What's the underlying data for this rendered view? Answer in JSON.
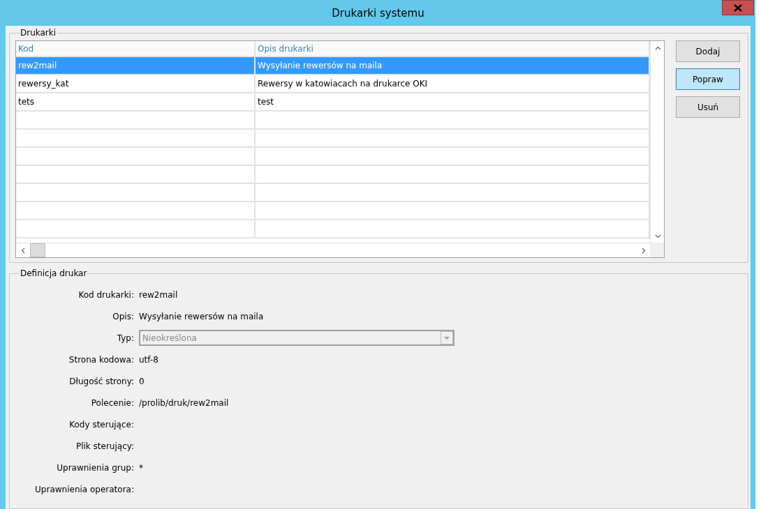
{
  "window": {
    "title": "Drukarki systemu"
  },
  "printers": {
    "legend": "Drukarki",
    "columns": [
      "Kod",
      "Opis drukarki"
    ],
    "rows": [
      {
        "cells": [
          "rew2mail",
          "Wysyłanie rewersów na maila"
        ],
        "selected": true
      },
      {
        "cells": [
          "rewersy_kat",
          "Rewersy w katowiacach na drukarce OKI"
        ],
        "selected": false
      },
      {
        "cells": [
          "tets",
          "test"
        ],
        "selected": false
      }
    ],
    "buttons": [
      {
        "label": "Dodaj",
        "focused": false
      },
      {
        "label": "Popraw",
        "focused": true
      },
      {
        "label": "Usuń",
        "focused": false
      }
    ]
  },
  "definition": {
    "legend": "Definicja drukar",
    "fields": [
      {
        "kind": "text",
        "label": "Kod drukarki:",
        "value": "rew2mail"
      },
      {
        "kind": "text",
        "label": "Opis:",
        "value": "Wysyłanie rewersów na maila"
      },
      {
        "kind": "combo",
        "label": "Typ:",
        "value": "Nieokreślona",
        "disabled": true
      },
      {
        "kind": "text",
        "label": "Strona kodowa:",
        "value": "utf-8"
      },
      {
        "kind": "text",
        "label": "Długość strony:",
        "value": "0"
      },
      {
        "kind": "text",
        "label": "Polecenie:",
        "value": "/prolib/druk/rew2mail"
      },
      {
        "kind": "text",
        "label": "Kody sterujące:"
      },
      {
        "kind": "text",
        "label": "Plik sterujący:"
      },
      {
        "kind": "text",
        "label": "Uprawnienia grup:",
        "value": "*"
      },
      {
        "kind": "text",
        "label": "Uprawnienia operatora:"
      }
    ]
  }
}
